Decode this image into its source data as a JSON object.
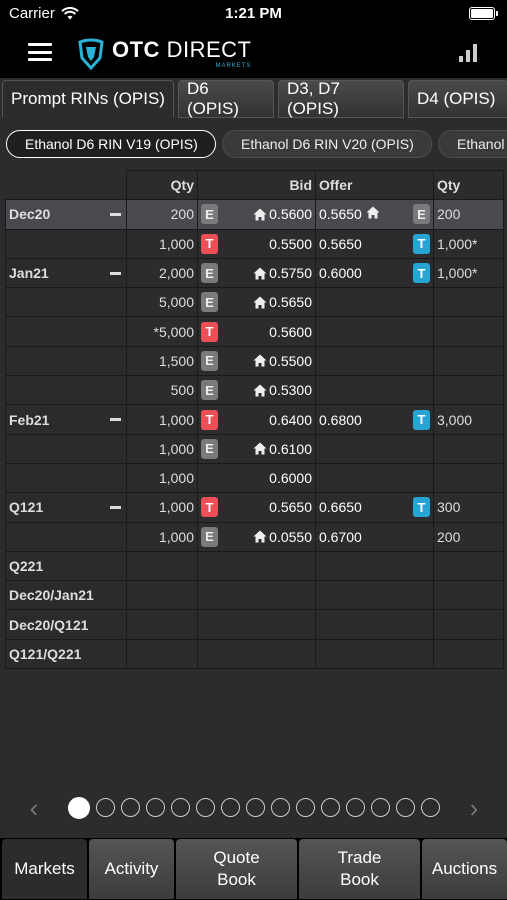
{
  "status_bar": {
    "carrier": "Carrier",
    "time": "1:21 PM"
  },
  "header": {
    "logo_main_bold": "OTC",
    "logo_main": "DIRECT",
    "logo_sub": "MARKETS"
  },
  "tabs": [
    {
      "label": "Prompt RINs (OPIS)",
      "active": true
    },
    {
      "label": "D6 (OPIS)",
      "active": false
    },
    {
      "label": "D3, D7 (OPIS)",
      "active": false
    },
    {
      "label": "D4 (OPIS)",
      "active": false
    }
  ],
  "chips": [
    {
      "label": "Ethanol D6 RIN V19 (OPIS)",
      "active": true
    },
    {
      "label": "Ethanol D6 RIN V20 (OPIS)",
      "active": false
    },
    {
      "label": "Ethanol",
      "active": false
    }
  ],
  "grid": {
    "headers": {
      "bid_qty": "Qty",
      "bid": "Bid",
      "offer": "Offer",
      "offer_qty": "Qty"
    },
    "rows": [
      {
        "label": "Dec20",
        "collapsible": true,
        "selected": true,
        "bid_qty": "200",
        "bid_badge": "E",
        "bid_home": true,
        "bid": "0.5600",
        "offer": "0.5650",
        "offer_home": true,
        "offer_badge": "E",
        "offer_qty": "200"
      },
      {
        "label": "",
        "bid_qty": "1,000",
        "bid_badge": "T",
        "bid": "0.5500",
        "offer": "0.5650",
        "offer_badge": "T",
        "offer_qty": "1,000*"
      },
      {
        "label": "Jan21",
        "collapsible": true,
        "bid_qty": "2,000",
        "bid_badge": "E",
        "bid_home": true,
        "bid": "0.5750",
        "offer": "0.6000",
        "offer_badge": "T",
        "offer_qty": "1,000*"
      },
      {
        "label": "",
        "bid_qty": "5,000",
        "bid_badge": "E",
        "bid_home": true,
        "bid": "0.5650",
        "offer": "",
        "offer_qty": ""
      },
      {
        "label": "",
        "bid_qty": "*5,000",
        "bid_badge": "T",
        "bid": "0.5600",
        "offer": "",
        "offer_qty": ""
      },
      {
        "label": "",
        "bid_qty": "1,500",
        "bid_badge": "E",
        "bid_home": true,
        "bid": "0.5500",
        "offer": "",
        "offer_qty": ""
      },
      {
        "label": "",
        "bid_qty": "500",
        "bid_badge": "E",
        "bid_home": true,
        "bid": "0.5300",
        "offer": "",
        "offer_qty": ""
      },
      {
        "label": "Feb21",
        "collapsible": true,
        "bid_qty": "1,000",
        "bid_badge": "T",
        "bid": "0.6400",
        "offer": "0.6800",
        "offer_badge": "T",
        "offer_qty": "3,000"
      },
      {
        "label": "",
        "bid_qty": "1,000",
        "bid_badge": "E",
        "bid_home": true,
        "bid": "0.6100",
        "offer": "",
        "offer_qty": ""
      },
      {
        "label": "",
        "bid_qty": "1,000",
        "bid": "0.6000",
        "offer": "",
        "offer_qty": ""
      },
      {
        "label": "Q121",
        "collapsible": true,
        "bid_qty": "1,000",
        "bid_badge": "T",
        "bid": "0.5650",
        "offer": "0.6650",
        "offer_badge": "T",
        "offer_qty": "300"
      },
      {
        "label": "",
        "bid_qty": "1,000",
        "bid_badge": "E",
        "bid_home": true,
        "bid": "0.0550",
        "offer": "0.6700",
        "offer_qty": "200"
      },
      {
        "label": "Q221",
        "bid_qty": "",
        "bid": "",
        "offer": "",
        "offer_qty": ""
      },
      {
        "label": "Dec20/Jan21",
        "bid_qty": "",
        "bid": "",
        "offer": "",
        "offer_qty": ""
      },
      {
        "label": "Dec20/Q121",
        "bid_qty": "",
        "bid": "",
        "offer": "",
        "offer_qty": ""
      },
      {
        "label": "Q121/Q221",
        "bid_qty": "",
        "bid": "",
        "offer": "",
        "offer_qty": ""
      }
    ]
  },
  "pager": {
    "total": 15,
    "active_index": 0,
    "prev_icon": "chevron-left-icon",
    "next_icon": "chevron-right-icon"
  },
  "bottom_tabs": [
    {
      "label": "Markets",
      "active": true
    },
    {
      "label": "Activity",
      "active": false
    },
    {
      "label": "Quote Book",
      "active": false
    },
    {
      "label": "Trade Book",
      "active": false
    },
    {
      "label": "Auctions",
      "active": false
    }
  ],
  "colors": {
    "badge_red": "#ee4e55",
    "badge_blue": "#26a5d4",
    "badge_grey": "#7a7a7c",
    "brand": "#2ab3d6"
  }
}
